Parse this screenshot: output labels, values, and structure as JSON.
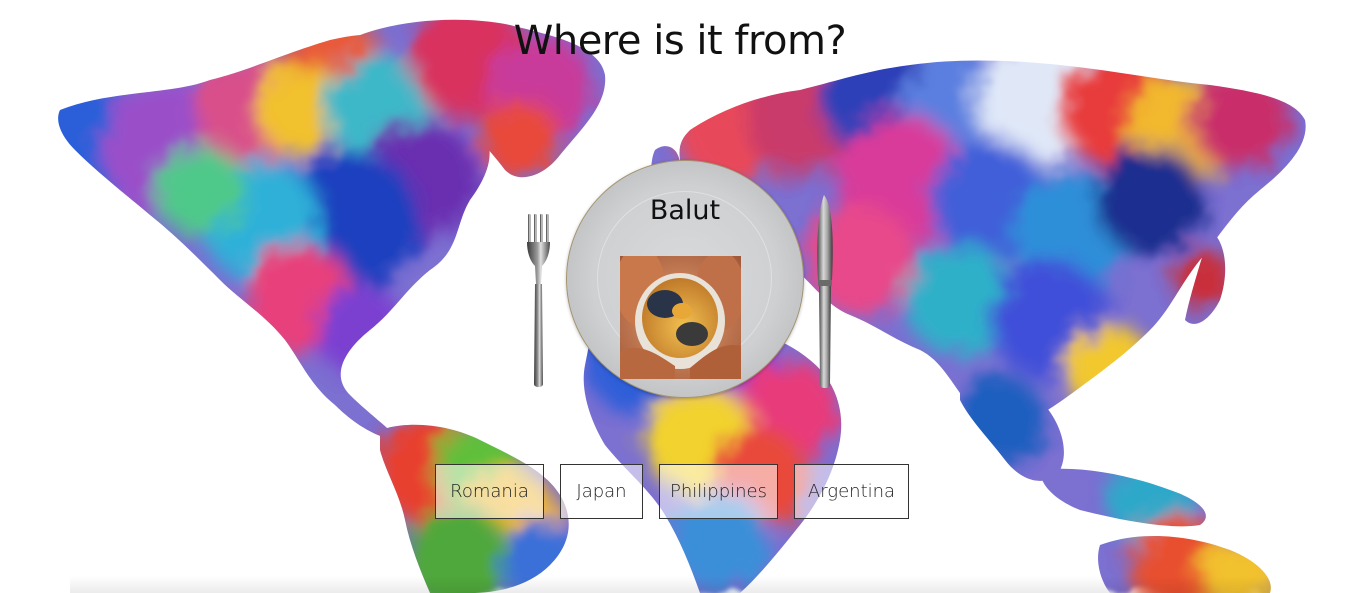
{
  "quiz": {
    "question": "Where is it from?",
    "dish_name": "Balut",
    "dish_image_alt": "balut-egg-photo",
    "answers": [
      "Romania",
      "Japan",
      "Philippines",
      "Argentina"
    ]
  },
  "icons": {
    "fork": "fork-icon",
    "knife": "knife-icon"
  },
  "colors": {
    "plate": "#cfd0d2",
    "button_border": "#333333",
    "text": "#111111"
  }
}
